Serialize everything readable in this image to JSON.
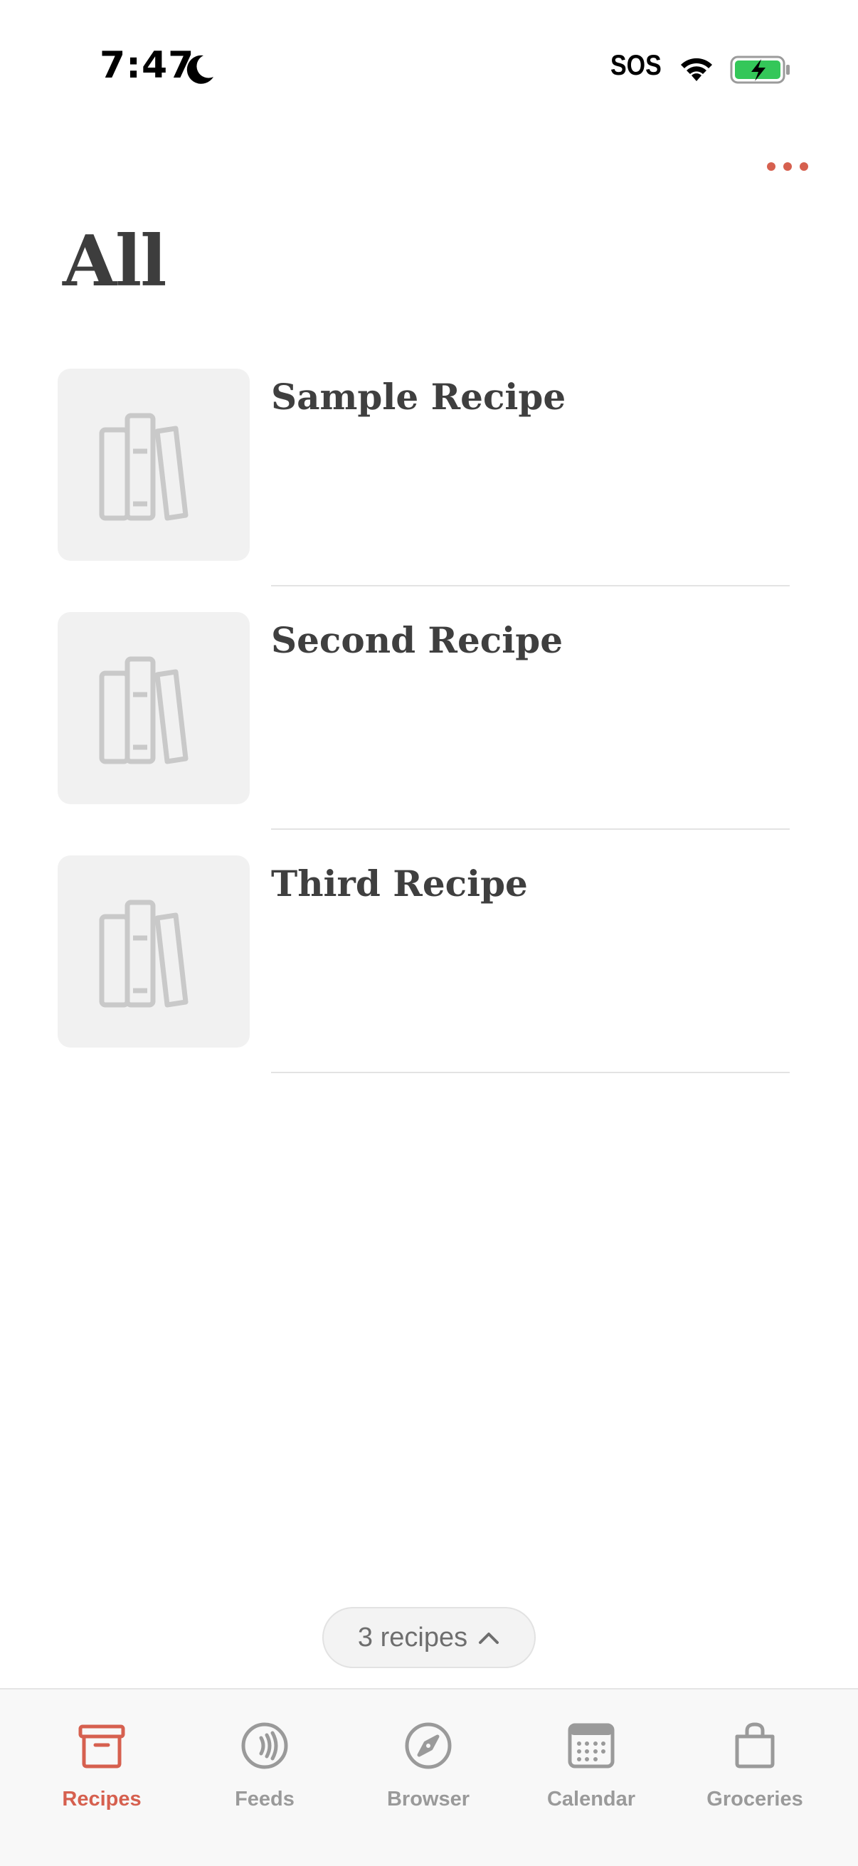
{
  "status_bar": {
    "time": "7:47",
    "carrier": "SOS"
  },
  "colors": {
    "accent": "#d6604f",
    "battery_fill": "#34c759",
    "tab_inactive": "#9a9a9a"
  },
  "page": {
    "title": "All"
  },
  "recipes": [
    {
      "title": "Sample Recipe",
      "image_icon": "books-placeholder-icon"
    },
    {
      "title": "Second Recipe",
      "image_icon": "books-placeholder-icon"
    },
    {
      "title": "Third Recipe",
      "image_icon": "books-placeholder-icon"
    }
  ],
  "count_pill": {
    "label": "3 recipes"
  },
  "tabs": [
    {
      "label": "Recipes",
      "icon": "archive-box-icon",
      "active": true
    },
    {
      "label": "Feeds",
      "icon": "feeds-icon",
      "active": false
    },
    {
      "label": "Browser",
      "icon": "compass-icon",
      "active": false
    },
    {
      "label": "Calendar",
      "icon": "calendar-icon",
      "active": false
    },
    {
      "label": "Groceries",
      "icon": "shopping-bag-icon",
      "active": false
    }
  ]
}
